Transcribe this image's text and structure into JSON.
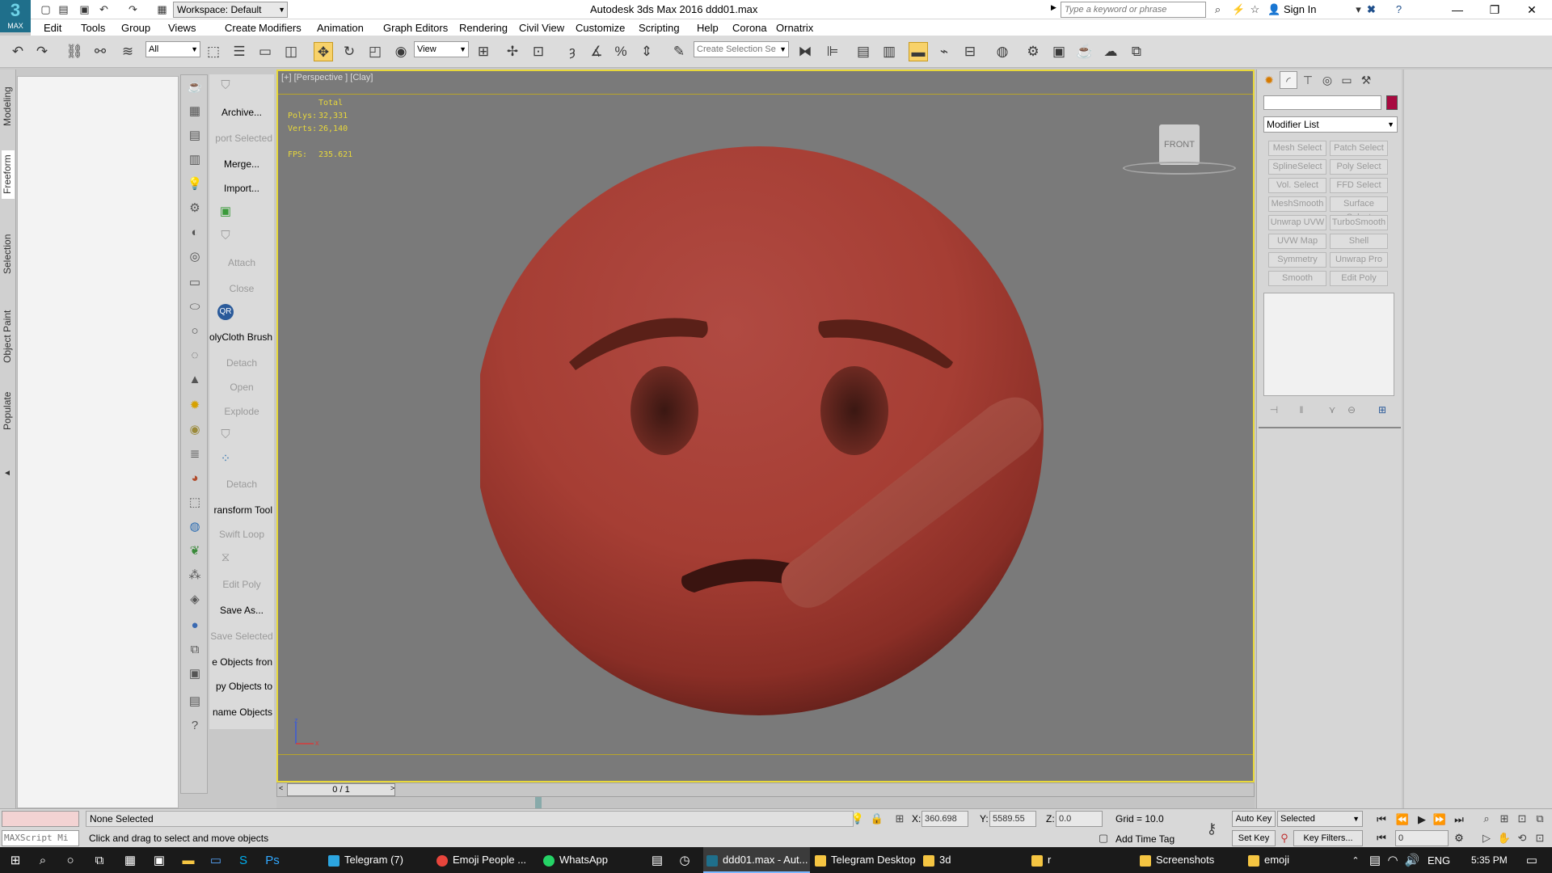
{
  "app": {
    "logo_text": "MAX",
    "workspace": "Workspace: Default",
    "window_title": "Autodesk 3ds Max 2016    ddd01.max",
    "search_placeholder": "Type a keyword or phrase",
    "sign_in": "Sign In"
  },
  "menu": [
    "Edit",
    "Tools",
    "Group",
    "Views",
    "Create",
    "Modifiers",
    "Animation",
    "Graph Editors",
    "Rendering",
    "Civil View",
    "Customize",
    "Scripting",
    "Help",
    "Corona",
    "Ornatrix"
  ],
  "toolbar": {
    "filter": "All",
    "ref_coord": "View",
    "selection_set": "Create Selection Se"
  },
  "ribbon_tabs": [
    "Modeling",
    "Freeform",
    "Selection",
    "Object Paint",
    "Populate"
  ],
  "tools": [
    {
      "label": "Archive...",
      "dim": false
    },
    {
      "label": "port Selected",
      "dim": true
    },
    {
      "label": "Merge...",
      "dim": false
    },
    {
      "label": "Import...",
      "dim": false
    },
    {
      "label": "Attach",
      "dim": true
    },
    {
      "label": "Close",
      "dim": true
    },
    {
      "label": "olyCloth Brush",
      "dim": false
    },
    {
      "label": "Detach",
      "dim": true
    },
    {
      "label": "Open",
      "dim": true
    },
    {
      "label": "Explode",
      "dim": true
    },
    {
      "label": "Detach",
      "dim": true
    },
    {
      "label": "ransform Tool",
      "dim": false
    },
    {
      "label": "Swift Loop",
      "dim": true
    },
    {
      "label": "Edit Poly",
      "dim": true
    },
    {
      "label": "Save As...",
      "dim": false
    },
    {
      "label": "Save Selected",
      "dim": true
    },
    {
      "label": "e Objects fron",
      "dim": false
    },
    {
      "label": "py Objects to",
      "dim": false
    },
    {
      "label": "name Objects",
      "dim": false
    }
  ],
  "viewport": {
    "label": "[+] [Perspective ] [Clay]",
    "stats_header": "Total",
    "polys_label": "Polys:",
    "polys": "32,331",
    "verts_label": "Verts:",
    "verts": "26,140",
    "fps_label": "FPS:",
    "fps": "235.621",
    "viewcube": "FRONT",
    "axis_z": "z",
    "axis_x": "x"
  },
  "command_panel": {
    "modifier_list": "Modifier List",
    "modifiers": [
      "Mesh Select",
      "Patch Select",
      "SplineSelect",
      "Poly Select",
      "Vol. Select",
      "FFD Select",
      "MeshSmooth",
      "Surface Select",
      "Unwrap UVW",
      "TurboSmooth",
      "UVW Map",
      "Shell",
      "Symmetry",
      "Unwrap Pro",
      "Smooth",
      "Edit Poly"
    ],
    "object_color": "#a80a40"
  },
  "timeline": {
    "frame": "0 / 1"
  },
  "status": {
    "maxscript": "MAXScript Mi",
    "selection": "None Selected",
    "prompt": "Click and drag to select and move objects",
    "x_label": "X:",
    "x": "360.698",
    "y_label": "Y:",
    "y": "5589.55",
    "z_label": "Z:",
    "z": "0.0",
    "grid": "Grid = 10.0",
    "add_time_tag": "Add Time Tag",
    "auto_key": "Auto Key",
    "set_key": "Set Key",
    "key_mode": "Selected",
    "key_filters": "Key Filters...",
    "frame_input": "0"
  },
  "taskbar": {
    "items": [
      "Telegram (7)",
      "Emoji People ...",
      "WhatsApp",
      "ddd01.max - Aut...",
      "Telegram Desktop",
      "3d",
      "r",
      "Screenshots",
      "emoji"
    ],
    "lang": "ENG",
    "time": "5:35 PM"
  }
}
